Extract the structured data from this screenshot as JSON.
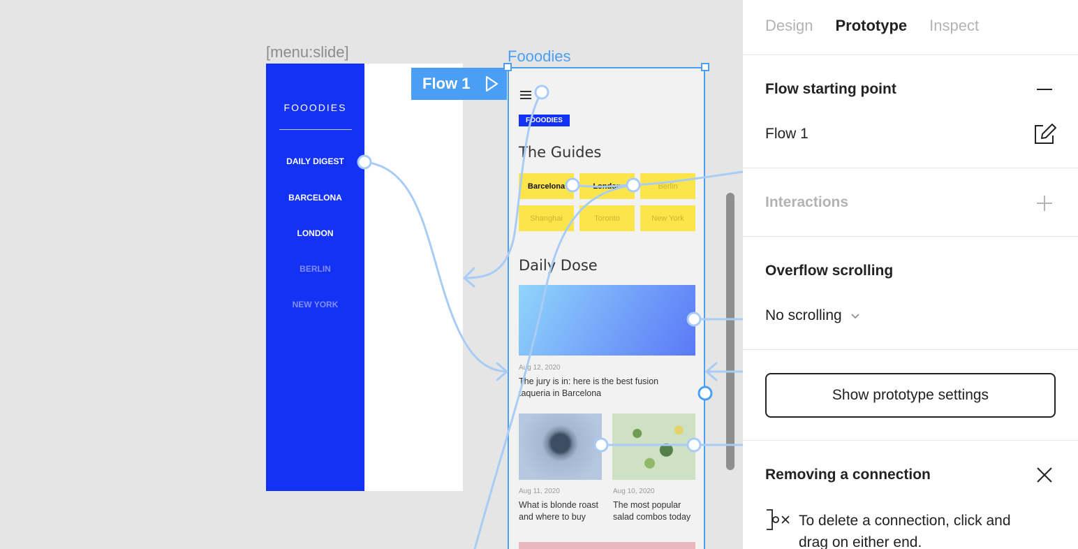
{
  "canvas": {
    "menu_frame_label": "[menu:slide]",
    "app_frame_label": "Fooodies",
    "flow_tag": "Flow 1",
    "menu": {
      "brand": "FOOODIES",
      "items": [
        {
          "label": "DAILY DIGEST",
          "dim": false
        },
        {
          "label": "BARCELONA",
          "dim": false
        },
        {
          "label": "LONDON",
          "dim": false
        },
        {
          "label": "BERLIN",
          "dim": true
        },
        {
          "label": "NEW YORK",
          "dim": true
        }
      ]
    },
    "app": {
      "badge": "FOOODIES",
      "guides_heading": "The Guides",
      "guides": [
        {
          "label": "Barcelona",
          "active": true
        },
        {
          "label": "London",
          "active": true
        },
        {
          "label": "Berlin",
          "active": false
        },
        {
          "label": "Shanghai",
          "active": false
        },
        {
          "label": "Toronto",
          "active": false
        },
        {
          "label": "New York",
          "active": false
        }
      ],
      "daily_heading": "Daily Dose",
      "hero_post": {
        "date": "Aug 12, 2020",
        "title": "The jury is in: here is the best fusion taqueria in Barcelona"
      },
      "posts": [
        {
          "date": "Aug 11, 2020",
          "title": "What is blonde roast and where to buy"
        },
        {
          "date": "Aug 10, 2020",
          "title": "The most popular salad combos today"
        }
      ]
    }
  },
  "panel": {
    "tabs": [
      "Design",
      "Prototype",
      "Inspect"
    ],
    "active_tab": "Prototype",
    "flow_start": {
      "title": "Flow starting point",
      "flow_name": "Flow 1"
    },
    "interactions": {
      "title": "Interactions"
    },
    "overflow": {
      "title": "Overflow scrolling",
      "value": "No scrolling"
    },
    "prototype_settings_button": "Show prototype settings",
    "removing": {
      "title": "Removing a connection",
      "text": "To delete a connection, click and drag on either end."
    }
  },
  "colors": {
    "accent": "#4a9ff5",
    "brand_blue": "#1432f5",
    "tile_yellow": "#fce54a"
  }
}
